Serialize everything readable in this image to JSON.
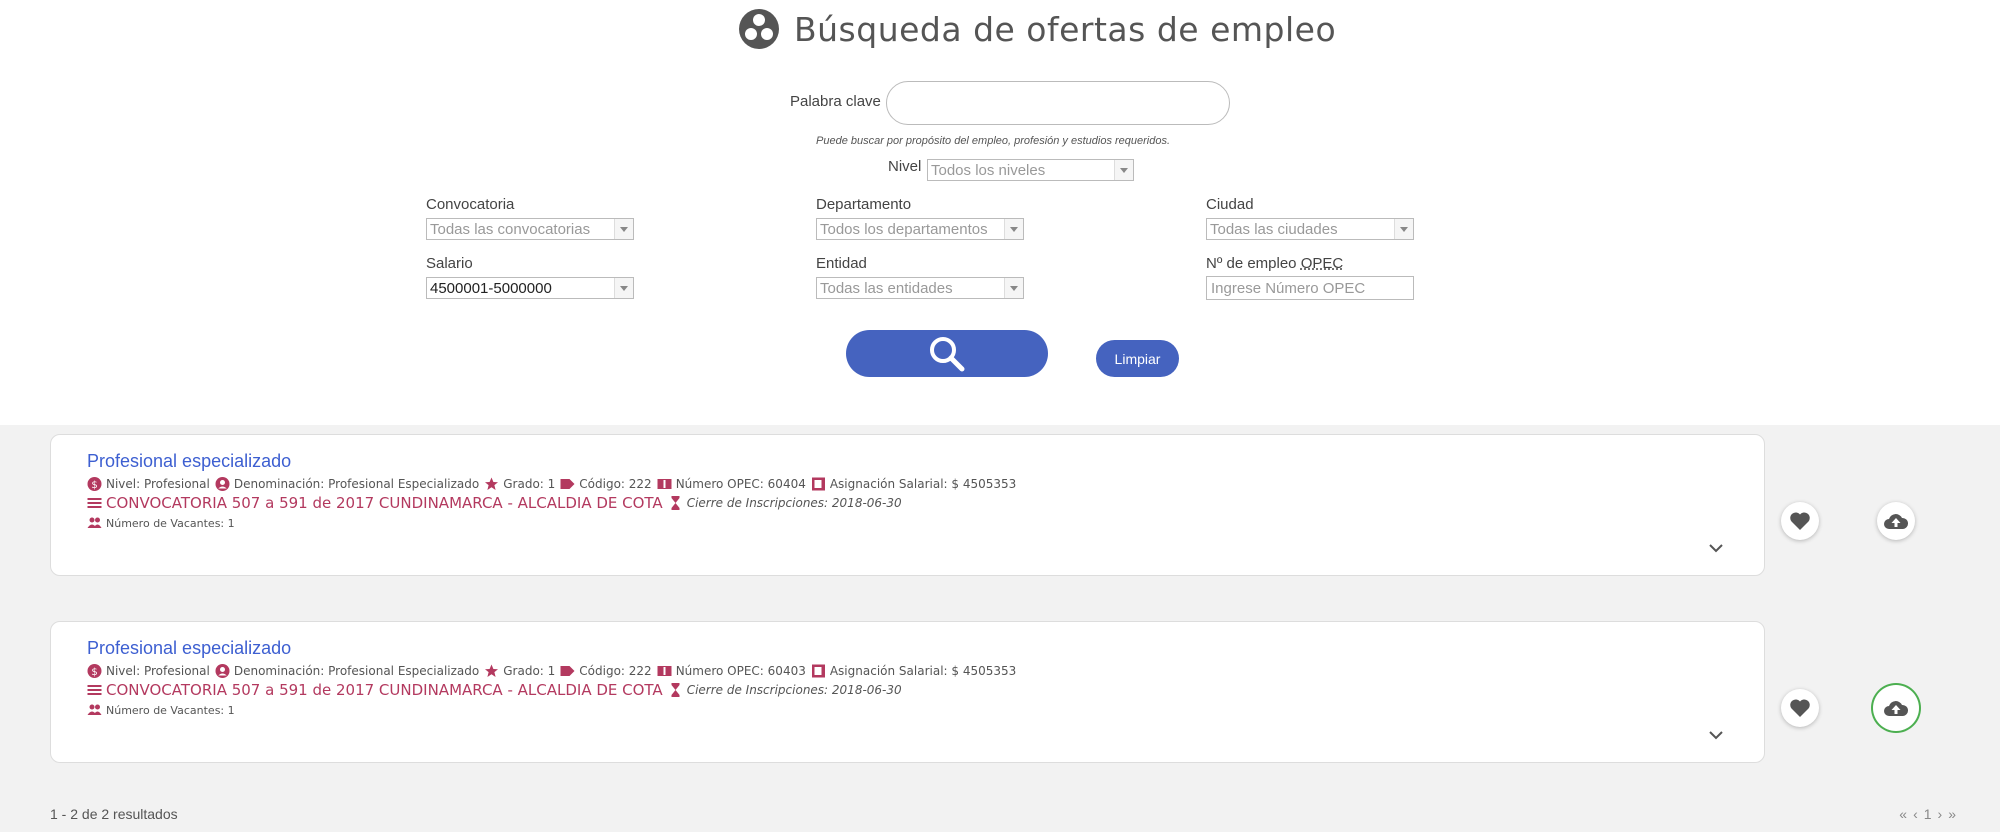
{
  "header": {
    "title": "Búsqueda de ofertas de empleo"
  },
  "search": {
    "keyword_label": "Palabra clave",
    "keyword_value": "",
    "keyword_hint": "Puede buscar por propósito del empleo, profesión y estudios requeridos.",
    "nivel_label": "Nivel",
    "nivel_value": "Todos los niveles",
    "convocatoria_label": "Convocatoria",
    "convocatoria_value": "Todas las convocatorias",
    "departamento_label": "Departamento",
    "departamento_value": "Todos los departamentos",
    "ciudad_label": "Ciudad",
    "ciudad_value": "Todas las ciudades",
    "salario_label": "Salario",
    "salario_value": "4500001-5000000",
    "entidad_label": "Entidad",
    "entidad_value": "Todas las entidades",
    "opec_label_prefix": "Nº de empleo ",
    "opec_label_abbr": "OPEC",
    "opec_placeholder": "Ingrese Número OPEC",
    "limpiar_label": "Limpiar"
  },
  "results": [
    {
      "title": "Profesional especializado",
      "nivel": "Nivel: Profesional",
      "denominacion": "Denominación: Profesional Especializado",
      "grado": "Grado: 1",
      "codigo": "Código: 222",
      "opec": "Número OPEC: 60404",
      "asignacion": "Asignación Salarial: $ 4505353",
      "convocatoria": "CONVOCATORIA 507 a 591 de 2017 CUNDINAMARCA - ALCALDIA DE COTA",
      "cierre": "Cierre de Inscripciones: 2018-06-30",
      "vacantes": "Número de Vacantes: 1"
    },
    {
      "title": "Profesional especializado",
      "nivel": "Nivel: Profesional",
      "denominacion": "Denominación: Profesional Especializado",
      "grado": "Grado: 1",
      "codigo": "Código: 222",
      "opec": "Número OPEC: 60403",
      "asignacion": "Asignación Salarial: $ 4505353",
      "convocatoria": "CONVOCATORIA 507 a 591 de 2017 CUNDINAMARCA - ALCALDIA DE COTA",
      "cierre": "Cierre de Inscripciones: 2018-06-30",
      "vacantes": "Número de Vacantes: 1"
    }
  ],
  "footer": {
    "count": "1 - 2 de 2 resultados",
    "pager_first": "«",
    "pager_prev": "‹",
    "pager_page": "1",
    "pager_next": "›",
    "pager_last": "»"
  },
  "colors": {
    "accent": "#4563bf",
    "link": "#3d5fd1",
    "red": "#b3395f",
    "highlight": "#4caf50"
  },
  "icons": [
    "three-circles-icon",
    "search-icon",
    "nivel-icon",
    "user-circle-icon",
    "star-icon",
    "tag-icon",
    "ticket-icon",
    "money-icon",
    "list-icon",
    "hourglass-icon",
    "users-icon",
    "chevron-down-icon",
    "heart-icon",
    "cloud-upload-icon"
  ]
}
